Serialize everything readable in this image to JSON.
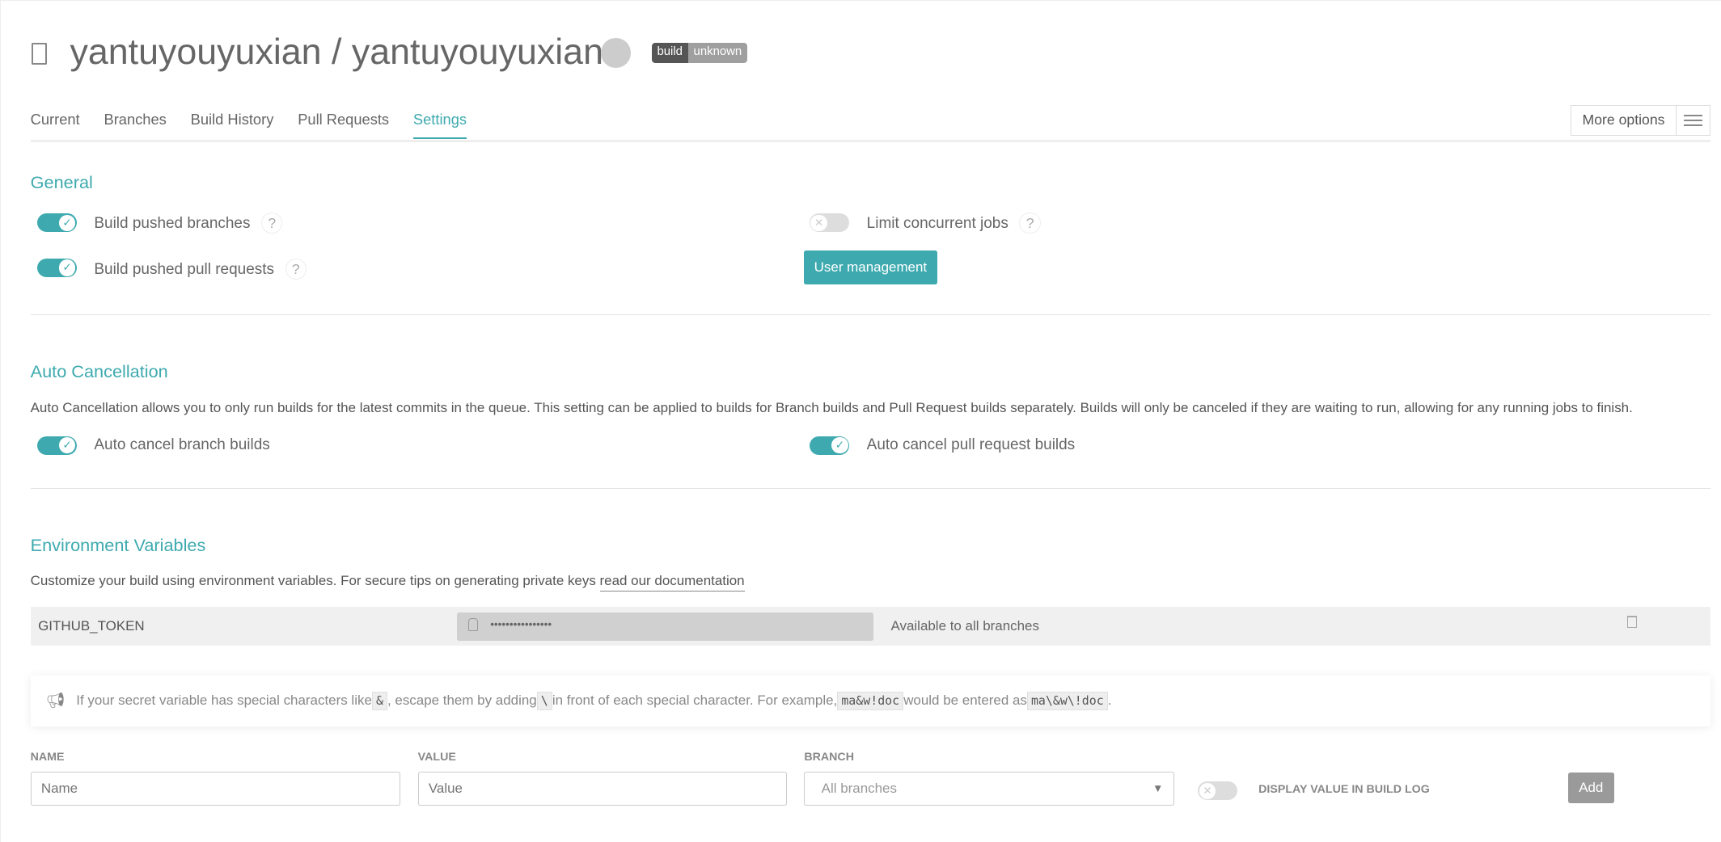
{
  "header": {
    "title": "yantuyouyuxian / yantuyouyuxian",
    "badge_left": "build",
    "badge_right": "unknown"
  },
  "tabs": [
    {
      "label": "Current"
    },
    {
      "label": "Branches"
    },
    {
      "label": "Build History"
    },
    {
      "label": "Pull Requests"
    },
    {
      "label": "Settings",
      "active": true
    }
  ],
  "more_options": "More options",
  "general": {
    "title": "General",
    "build_pushed_branches": "Build pushed branches",
    "build_pushed_prs": "Build pushed pull requests",
    "limit_concurrent": "Limit concurrent jobs",
    "user_management": "User management",
    "help": "?"
  },
  "auto_cancel": {
    "title": "Auto Cancellation",
    "description": "Auto Cancellation allows you to only run builds for the latest commits in the queue. This setting can be applied to builds for Branch builds and Pull Request builds separately. Builds will only be canceled if they are waiting to run, allowing for any running jobs to finish.",
    "branch": "Auto cancel branch builds",
    "pr": "Auto cancel pull request builds"
  },
  "env": {
    "title": "Environment Variables",
    "description": "Customize your build using environment variables. For secure tips on generating private keys ",
    "doc_link": "read our documentation",
    "vars": [
      {
        "name": "GITHUB_TOKEN",
        "value": "••••••••••••••••",
        "branch": "Available to all branches"
      }
    ],
    "note": {
      "p1": "If your secret variable has special characters like ",
      "c1": "&",
      "p2": ", escape them by adding ",
      "c2": "\\",
      "p3": " in front of each special character. For example, ",
      "c3": "ma&w!doc",
      "p4": " would be entered as ",
      "c4": "ma\\&w\\!doc",
      "p5": "."
    },
    "form": {
      "name_label": "NAME",
      "name_placeholder": "Name",
      "value_label": "VALUE",
      "value_placeholder": "Value",
      "branch_label": "BRANCH",
      "branch_value": "All branches",
      "display_label": "DISPLAY VALUE IN BUILD LOG",
      "add": "Add"
    }
  },
  "colors": {
    "accent": "#3eaaaf",
    "disabled_button": "#9a9a9a"
  }
}
